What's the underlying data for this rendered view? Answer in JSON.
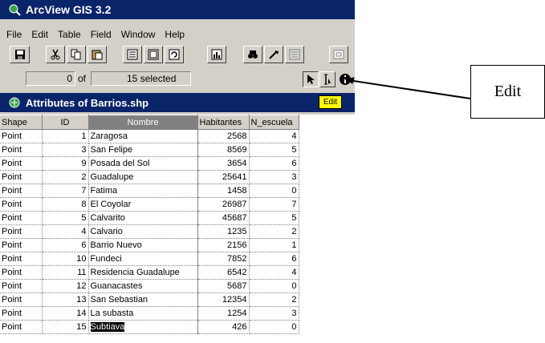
{
  "app": {
    "title": "ArcView GIS 3.2"
  },
  "menu": {
    "items": [
      "File",
      "Edit",
      "Table",
      "Field",
      "Window",
      "Help"
    ]
  },
  "toolbar": {
    "buttons": [
      "save-icon",
      "cut-icon",
      "copy-icon",
      "paste-icon",
      "select-all-icon",
      "select-none-icon",
      "refresh-icon",
      "chart-icon",
      "find-icon",
      "query-icon",
      "promote-icon",
      "zoom-to-selected-icon"
    ]
  },
  "status": {
    "selected_count": "0",
    "of_label": "of",
    "total_text": "15 selected"
  },
  "table_window": {
    "title": "Attributes of Barrios.shp",
    "tooltip": "Edit",
    "columns": [
      "Shape",
      "ID",
      "Nombre",
      "Habitantes",
      "N_escuela"
    ],
    "rows": [
      [
        "Point",
        "1",
        "Zaragosa",
        "2568",
        "4"
      ],
      [
        "Point",
        "3",
        "San Felipe",
        "8569",
        "5"
      ],
      [
        "Point",
        "9",
        "Posada del Sol",
        "3654",
        "6"
      ],
      [
        "Point",
        "2",
        "Guadalupe",
        "25641",
        "3"
      ],
      [
        "Point",
        "7",
        "Fatima",
        "1458",
        "0"
      ],
      [
        "Point",
        "8",
        "El Coyolar",
        "26987",
        "7"
      ],
      [
        "Point",
        "5",
        "Calvarito",
        "45687",
        "5"
      ],
      [
        "Point",
        "4",
        "Calvario",
        "1235",
        "2"
      ],
      [
        "Point",
        "6",
        "Barrio Nuevo",
        "2156",
        "1"
      ],
      [
        "Point",
        "10",
        "Fundeci",
        "7852",
        "6"
      ],
      [
        "Point",
        "11",
        "Residencia Guadalupe",
        "6542",
        "4"
      ],
      [
        "Point",
        "12",
        "Guanacastes",
        "5687",
        "0"
      ],
      [
        "Point",
        "13",
        "San Sebastian",
        "12354",
        "2"
      ],
      [
        "Point",
        "14",
        "La subasta",
        "1254",
        "3"
      ],
      [
        "Point",
        "15",
        "Subtiava",
        "426",
        "0"
      ]
    ]
  },
  "annotation": {
    "label": "Edit"
  },
  "colors": {
    "titlebar": "#0a246a",
    "window_bg": "#d4d0c8",
    "tooltip_bg": "#ffff00"
  }
}
